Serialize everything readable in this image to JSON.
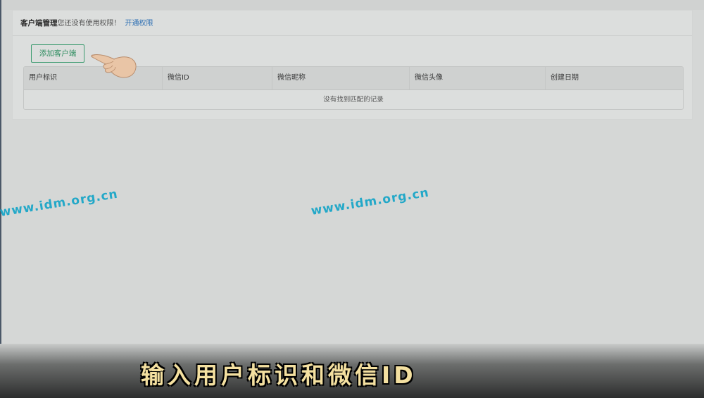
{
  "header": {
    "title": "客户端管理",
    "note": "您还没有使用权限！",
    "link": "开通权限"
  },
  "toolbar": {
    "add_label": "添加客户端"
  },
  "table": {
    "columns": [
      "用户标识",
      "微信ID",
      "微信昵称",
      "微信头像",
      "创建日期"
    ],
    "empty_text": "没有找到匹配的记录"
  },
  "watermarks": [
    "www.idm.org.cn",
    "www.idm.org.cn"
  ],
  "subtitle": "输入用户标识和微信ID",
  "icons": {
    "pointer": "pointing-hand-icon"
  },
  "colors": {
    "accent_green": "#3a9a6e",
    "link_blue": "#2d6fb3",
    "watermark": "#1aa6c8",
    "subtitle": "#f4e0a0"
  }
}
